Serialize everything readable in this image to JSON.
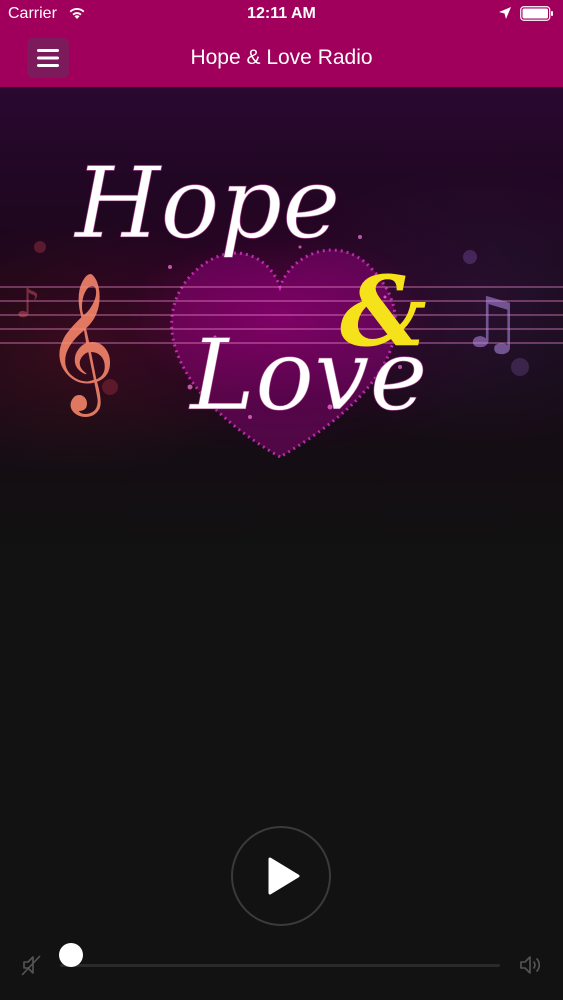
{
  "status_bar": {
    "carrier": "Carrier",
    "time": "12:11 AM",
    "wifi_icon": "wifi-icon",
    "location_icon": "location-arrow-icon",
    "battery_icon": "battery-full-icon"
  },
  "navbar": {
    "title": "Hope & Love Radio",
    "menu_icon": "hamburger-menu-icon",
    "background": "#a0005c"
  },
  "artwork": {
    "line1": "Hope",
    "ampersand": "&",
    "line2": "Love"
  },
  "player": {
    "play_icon": "play-icon",
    "mute_icon": "speaker-muted-icon",
    "volume_icon": "speaker-volume-icon",
    "volume_level": 0
  },
  "colors": {
    "accent": "#a0005c",
    "background": "#121212",
    "ampersand": "#f5e21b"
  }
}
